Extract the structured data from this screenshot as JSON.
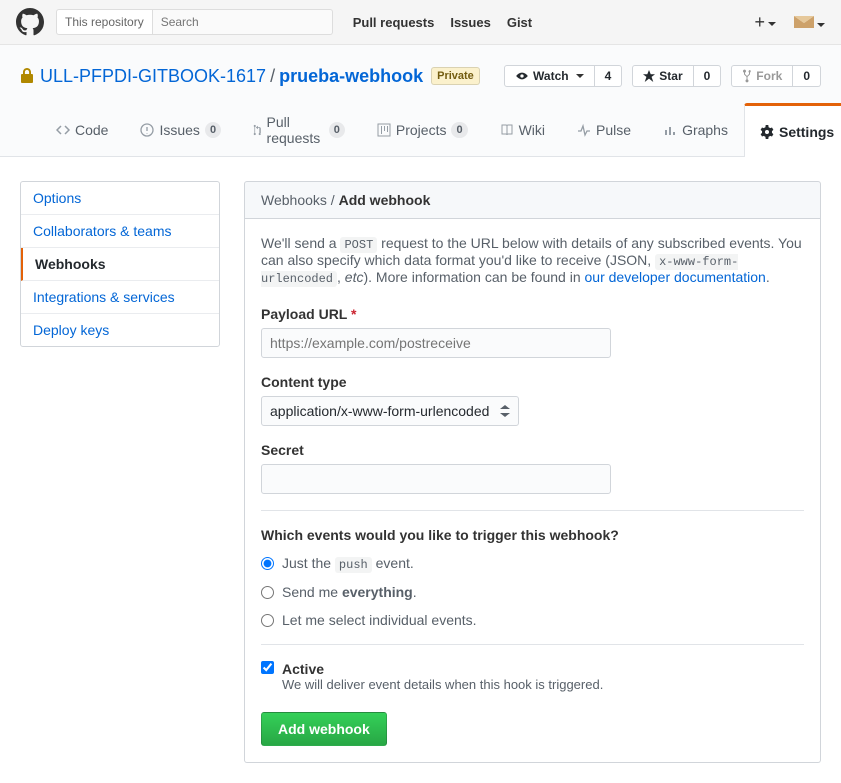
{
  "topbar": {
    "search_scope": "This repository",
    "search_placeholder": "Search",
    "nav": [
      "Pull requests",
      "Issues",
      "Gist"
    ]
  },
  "repo": {
    "owner": "ULL-PFPDI-GITBOOK-1617",
    "name": "prueba-webhook",
    "visibility": "Private",
    "watch": {
      "label": "Watch",
      "count": "4"
    },
    "star": {
      "label": "Star",
      "count": "0"
    },
    "fork": {
      "label": "Fork",
      "count": "0"
    }
  },
  "tabs": {
    "code": "Code",
    "issues": {
      "label": "Issues",
      "count": "0"
    },
    "pulls": {
      "label": "Pull requests",
      "count": "0"
    },
    "projects": {
      "label": "Projects",
      "count": "0"
    },
    "wiki": "Wiki",
    "pulse": "Pulse",
    "graphs": "Graphs",
    "settings": "Settings"
  },
  "sidebar": {
    "items": [
      "Options",
      "Collaborators & teams",
      "Webhooks",
      "Integrations & services",
      "Deploy keys"
    ]
  },
  "breadcrumb": {
    "parent": "Webhooks",
    "current": "Add webhook"
  },
  "help": {
    "prefix": "We'll send a ",
    "code1": "POST",
    "mid1": " request to the URL below with details of any subscribed events. You can also specify which data format you'd like to receive (JSON, ",
    "code2": "x-www-form-urlencoded",
    "mid2": ", ",
    "etc": "etc",
    "suffix": "). More information can be found in ",
    "link": "our developer documentation",
    "end": "."
  },
  "form": {
    "payload_label": "Payload URL",
    "payload_placeholder": "https://example.com/postreceive",
    "content_type_label": "Content type",
    "content_type_value": "application/x-www-form-urlencoded",
    "secret_label": "Secret",
    "events_heading": "Which events would you like to trigger this webhook?",
    "opt_push_pre": "Just the ",
    "opt_push_code": "push",
    "opt_push_post": " event.",
    "opt_everything_pre": "Send me ",
    "opt_everything_bold": "everything",
    "opt_everything_post": ".",
    "opt_individual": "Let me select individual events.",
    "active_label": "Active",
    "active_desc": "We will deliver event details when this hook is triggered.",
    "submit": "Add webhook"
  }
}
